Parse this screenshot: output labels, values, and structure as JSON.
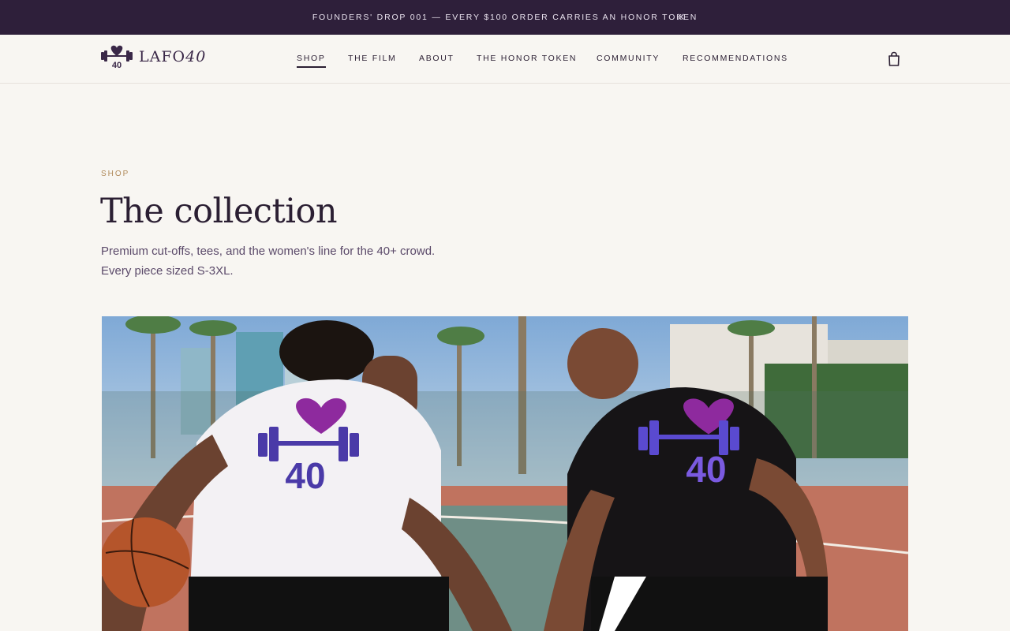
{
  "announcement": {
    "text": "FOUNDERS' DROP 001 — EVERY $100 ORDER CARRIES AN HONOR TOKEN",
    "close_icon": "close-icon"
  },
  "header": {
    "logo": {
      "text_main": "LAFO",
      "text_num": "40",
      "mark_icon": "heart-barbell-40-icon"
    },
    "nav": [
      {
        "label": "SHOP",
        "active": true
      },
      {
        "label": "THE FILM",
        "active": false
      },
      {
        "label": "ABOUT",
        "active": false
      },
      {
        "label": "THE HONOR TOKEN",
        "active": false
      },
      {
        "label": "COMMUNITY",
        "active": false
      },
      {
        "label": "RECOMMENDATIONS",
        "active": false
      }
    ],
    "cart_icon": "shopping-bag-icon"
  },
  "page": {
    "eyebrow": "SHOP",
    "title": "The collection",
    "subtitle_line1": "Premium cut-offs, tees, and the women's line for the 40+ crowd.",
    "subtitle_line2": "Every piece sized S-3XL."
  },
  "hero": {
    "shirt_graphic_text": "40"
  },
  "colors": {
    "announcement_bg": "#2e1f3a",
    "page_bg": "#f8f6f2",
    "brand_purple": "#3a2848",
    "eyebrow_gold": "#b08a5a",
    "heart_magenta": "#8e2a9e"
  }
}
